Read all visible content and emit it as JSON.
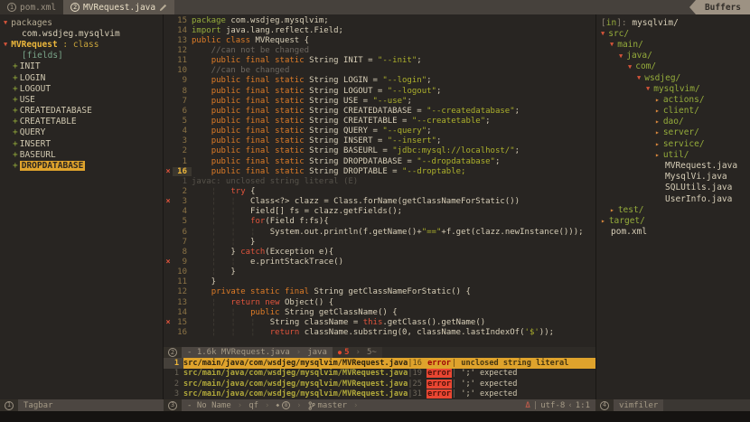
{
  "tabline": {
    "tabs": [
      {
        "num": "1",
        "label": "pom.xml"
      },
      {
        "num": "2",
        "label": "MVRequest.java"
      }
    ],
    "buffers_label": "Buffers"
  },
  "tagbar": {
    "items": [
      {
        "ind": 0,
        "arrow": "▼",
        "segs": [
          [
            "tb-top",
            "packages"
          ]
        ]
      },
      {
        "ind": 4,
        "segs": [
          [
            "tb-light",
            "com.wsdjeg.mysqlvim"
          ]
        ]
      },
      {
        "ind": 0,
        "arrow": "▼",
        "segs": [
          [
            "tb-name",
            "MVRequest"
          ],
          [
            "tb-kind",
            " : class"
          ]
        ]
      },
      {
        "ind": 4,
        "segs": [
          [
            "tb-fields",
            "[fields]"
          ]
        ]
      },
      {
        "ind": 2,
        "segs": [
          [
            "tb-plus",
            "+"
          ],
          [
            "tb-item",
            "INIT"
          ]
        ]
      },
      {
        "ind": 2,
        "segs": [
          [
            "tb-plus",
            "+"
          ],
          [
            "tb-item",
            "LOGIN"
          ]
        ]
      },
      {
        "ind": 2,
        "segs": [
          [
            "tb-plus",
            "+"
          ],
          [
            "tb-item",
            "LOGOUT"
          ]
        ]
      },
      {
        "ind": 2,
        "segs": [
          [
            "tb-plus",
            "+"
          ],
          [
            "tb-item",
            "USE"
          ]
        ]
      },
      {
        "ind": 2,
        "segs": [
          [
            "tb-plus",
            "+"
          ],
          [
            "tb-item",
            "CREATEDATABASE"
          ]
        ]
      },
      {
        "ind": 2,
        "segs": [
          [
            "tb-plus",
            "+"
          ],
          [
            "tb-item",
            "CREATETABLE"
          ]
        ]
      },
      {
        "ind": 2,
        "segs": [
          [
            "tb-plus",
            "+"
          ],
          [
            "tb-item",
            "QUERY"
          ]
        ]
      },
      {
        "ind": 2,
        "segs": [
          [
            "tb-plus",
            "+"
          ],
          [
            "tb-item",
            "INSERT"
          ]
        ]
      },
      {
        "ind": 2,
        "segs": [
          [
            "tb-plus",
            "+"
          ],
          [
            "tb-item",
            "BASEURL"
          ]
        ]
      },
      {
        "ind": 2,
        "segs": [
          [
            "tb-plus",
            "+"
          ],
          [
            "tb-sel",
            "DROPDATABASE"
          ]
        ]
      }
    ],
    "status_num": "1",
    "status_label": "Tagbar"
  },
  "code": {
    "lines": [
      {
        "nr": "15",
        "segs": [
          [
            "pkg",
            "package "
          ],
          [
            "idf",
            "com.wsdjeg.mysqlvim;"
          ]
        ]
      },
      {
        "nr": "14",
        "segs": [
          [
            "pkg",
            "import "
          ],
          [
            "idf",
            "java.lang.reflect.Field;"
          ]
        ]
      },
      {
        "nr": "13",
        "segs": [
          [
            "kwo",
            "public class "
          ],
          [
            "idf",
            "MVRequest {"
          ]
        ]
      },
      {
        "nr": "12",
        "segs": [
          [
            "cmt",
            "    //can not be changed"
          ]
        ]
      },
      {
        "nr": "11",
        "segs": [
          [
            "idf",
            "    "
          ],
          [
            "kwo",
            "public final static "
          ],
          [
            "idf",
            "String INIT = "
          ],
          [
            "str",
            "\"--init\""
          ],
          [
            "idf",
            ";"
          ]
        ]
      },
      {
        "nr": "10",
        "segs": [
          [
            "cmt",
            "    //can be changed"
          ]
        ]
      },
      {
        "nr": "9",
        "segs": [
          [
            "idf",
            "    "
          ],
          [
            "kwo",
            "public final static "
          ],
          [
            "idf",
            "String LOGIN = "
          ],
          [
            "str",
            "\"--login\""
          ],
          [
            "idf",
            ";"
          ]
        ]
      },
      {
        "nr": "8",
        "segs": [
          [
            "idf",
            "    "
          ],
          [
            "kwo",
            "public final static "
          ],
          [
            "idf",
            "String LOGOUT = "
          ],
          [
            "str",
            "\"--logout\""
          ],
          [
            "idf",
            ";"
          ]
        ]
      },
      {
        "nr": "7",
        "segs": [
          [
            "idf",
            "    "
          ],
          [
            "kwo",
            "public final static "
          ],
          [
            "idf",
            "String USE = "
          ],
          [
            "str",
            "\"--use\""
          ],
          [
            "idf",
            ";"
          ]
        ]
      },
      {
        "nr": "6",
        "segs": [
          [
            "idf",
            "    "
          ],
          [
            "kwo",
            "public final static "
          ],
          [
            "idf",
            "String CREATEDATABASE = "
          ],
          [
            "str",
            "\"--createdatabase\""
          ],
          [
            "idf",
            ";"
          ]
        ]
      },
      {
        "nr": "5",
        "segs": [
          [
            "idf",
            "    "
          ],
          [
            "kwo",
            "public final static "
          ],
          [
            "idf",
            "String CREATETABLE = "
          ],
          [
            "str",
            "\"--createtable\""
          ],
          [
            "idf",
            ";"
          ]
        ]
      },
      {
        "nr": "4",
        "segs": [
          [
            "idf",
            "    "
          ],
          [
            "kwo",
            "public final static "
          ],
          [
            "idf",
            "String QUERY = "
          ],
          [
            "str",
            "\"--query\""
          ],
          [
            "idf",
            ";"
          ]
        ]
      },
      {
        "nr": "3",
        "segs": [
          [
            "idf",
            "    "
          ],
          [
            "kwo",
            "public final static "
          ],
          [
            "idf",
            "String INSERT = "
          ],
          [
            "str",
            "\"--insert\""
          ],
          [
            "idf",
            ";"
          ]
        ]
      },
      {
        "nr": "2",
        "segs": [
          [
            "idf",
            "    "
          ],
          [
            "kwo",
            "public final static "
          ],
          [
            "idf",
            "String BASEURL = "
          ],
          [
            "str",
            "\"jdbc:mysql://localhost/\""
          ],
          [
            "idf",
            ";"
          ]
        ]
      },
      {
        "nr": "1",
        "segs": [
          [
            "idf",
            "    "
          ],
          [
            "kwo",
            "public final static "
          ],
          [
            "idf",
            "String DROPDATABASE = "
          ],
          [
            "str",
            "\"--dropdatabase\""
          ],
          [
            "idf",
            ";"
          ]
        ]
      },
      {
        "nr": "16",
        "cur": true,
        "sign": "×",
        "segs": [
          [
            "idf",
            "    "
          ],
          [
            "kwo",
            "public final static "
          ],
          [
            "idf",
            "String DROPTABLE = "
          ],
          [
            "str",
            "\"--droptable;"
          ]
        ]
      },
      {
        "nr": "1",
        "dim": true,
        "virt": true,
        "segs": [
          [
            "virt",
            "javac: unclosed string literal (E)"
          ]
        ]
      },
      {
        "nr": "2",
        "segs": [
          [
            "idf",
            "    "
          ],
          [
            "gde",
            "¦"
          ],
          [
            "idf",
            "   "
          ],
          [
            "kwr",
            "try "
          ],
          [
            "idf",
            "{"
          ]
        ]
      },
      {
        "nr": "3",
        "sign": "×",
        "segs": [
          [
            "idf",
            "    "
          ],
          [
            "gde",
            "¦"
          ],
          [
            "idf",
            "   "
          ],
          [
            "gde",
            "¦"
          ],
          [
            "idf",
            "   Class<?> clazz = Class.forName(getClassNameForStatic())"
          ]
        ]
      },
      {
        "nr": "4",
        "segs": [
          [
            "idf",
            "    "
          ],
          [
            "gde",
            "¦"
          ],
          [
            "idf",
            "   "
          ],
          [
            "gde",
            "¦"
          ],
          [
            "idf",
            "   Field[] fs = clazz.getFields();"
          ]
        ]
      },
      {
        "nr": "5",
        "segs": [
          [
            "idf",
            "    "
          ],
          [
            "gde",
            "¦"
          ],
          [
            "idf",
            "   "
          ],
          [
            "gde",
            "¦"
          ],
          [
            "idf",
            "   "
          ],
          [
            "kwr",
            "for"
          ],
          [
            "idf",
            "(Field f:fs){"
          ]
        ]
      },
      {
        "nr": "6",
        "segs": [
          [
            "idf",
            "    "
          ],
          [
            "gde",
            "¦"
          ],
          [
            "idf",
            "   "
          ],
          [
            "gde",
            "¦"
          ],
          [
            "idf",
            "   "
          ],
          [
            "gde",
            "¦"
          ],
          [
            "idf",
            "   System.out.println(f.getName()+"
          ],
          [
            "str",
            "\"==\""
          ],
          [
            "idf",
            "+f.get(clazz.newInstance()));"
          ]
        ]
      },
      {
        "nr": "7",
        "segs": [
          [
            "idf",
            "    "
          ],
          [
            "gde",
            "¦"
          ],
          [
            "idf",
            "   "
          ],
          [
            "gde",
            "¦"
          ],
          [
            "idf",
            "   }"
          ]
        ]
      },
      {
        "nr": "8",
        "segs": [
          [
            "idf",
            "    "
          ],
          [
            "gde",
            "¦"
          ],
          [
            "idf",
            "   } "
          ],
          [
            "kwr",
            "catch"
          ],
          [
            "idf",
            "(Exception e){"
          ]
        ]
      },
      {
        "nr": "9",
        "sign": "×",
        "segs": [
          [
            "idf",
            "    "
          ],
          [
            "gde",
            "¦"
          ],
          [
            "idf",
            "   "
          ],
          [
            "gde",
            "¦"
          ],
          [
            "idf",
            "   e.printStackTrace()"
          ]
        ]
      },
      {
        "nr": "10",
        "segs": [
          [
            "idf",
            "    "
          ],
          [
            "gde",
            "¦"
          ],
          [
            "idf",
            "   }"
          ]
        ]
      },
      {
        "nr": "11",
        "segs": [
          [
            "idf",
            "    }"
          ]
        ]
      },
      {
        "nr": "12",
        "segs": [
          [
            "idf",
            "    "
          ],
          [
            "kwo",
            "private static final "
          ],
          [
            "idf",
            "String getClassNameForStatic() {"
          ]
        ]
      },
      {
        "nr": "13",
        "segs": [
          [
            "idf",
            "    "
          ],
          [
            "gde",
            "¦"
          ],
          [
            "idf",
            "   "
          ],
          [
            "kwr",
            "return new "
          ],
          [
            "idf",
            "Object() {"
          ]
        ]
      },
      {
        "nr": "14",
        "segs": [
          [
            "idf",
            "    "
          ],
          [
            "gde",
            "¦"
          ],
          [
            "idf",
            "   "
          ],
          [
            "gde",
            "¦"
          ],
          [
            "idf",
            "   "
          ],
          [
            "kwo",
            "public "
          ],
          [
            "idf",
            "String getClassName() {"
          ]
        ]
      },
      {
        "nr": "15",
        "sign": "×",
        "segs": [
          [
            "idf",
            "    "
          ],
          [
            "gde",
            "¦"
          ],
          [
            "idf",
            "   "
          ],
          [
            "gde",
            "¦"
          ],
          [
            "idf",
            "   "
          ],
          [
            "gde",
            "¦"
          ],
          [
            "idf",
            "   String className = "
          ],
          [
            "kwr",
            "this"
          ],
          [
            "idf",
            ".getClass().getName()"
          ]
        ]
      },
      {
        "nr": "16",
        "segs": [
          [
            "idf",
            "    "
          ],
          [
            "gde",
            "¦"
          ],
          [
            "idf",
            "   "
          ],
          [
            "gde",
            "¦"
          ],
          [
            "idf",
            "   "
          ],
          [
            "gde",
            "¦"
          ],
          [
            "idf",
            "   "
          ],
          [
            "kwr",
            "return "
          ],
          [
            "idf",
            "className.substring(0, className.lastIndexOf("
          ],
          [
            "str",
            "'$'"
          ],
          [
            "idf",
            "));"
          ]
        ]
      }
    ]
  },
  "buffer_status": {
    "num": "2",
    "info": "- 1.6k MVRequest.java",
    "filetype": "java",
    "err_dot": "●",
    "err_count": "5",
    "scroll": "5~"
  },
  "quickfix": {
    "rows": [
      {
        "nr": "1",
        "cur": true,
        "path": "src/main/java/com/wsdjeg/mysqlvim/MVRequest.java",
        "line": "16",
        "tag": "error",
        "msg": "unclosed string literal"
      },
      {
        "nr": "1",
        "path": "src/main/java/com/wsdjeg/mysqlvim/MVRequest.java",
        "line": "19",
        "tag": "error",
        "msg": "';' expected"
      },
      {
        "nr": "2",
        "path": "src/main/java/com/wsdjeg/mysqlvim/MVRequest.java",
        "line": "25",
        "tag": "error",
        "msg": "';' expected"
      },
      {
        "nr": "3",
        "path": "src/main/java/com/wsdjeg/mysqlvim/MVRequest.java",
        "line": "31",
        "tag": "error",
        "msg": "';' expected"
      }
    ]
  },
  "qf_status": {
    "num": "3",
    "name": "- No Name",
    "filetype": "qf",
    "diamond": "◆",
    "count": "8",
    "branch": "master",
    "os": "Δ",
    "sep": "|",
    "encoding": "utf-8",
    "sep2": "‹",
    "position": "1:1"
  },
  "filer": {
    "header_open": "[",
    "header_mode": "in",
    "header_close": "]: ",
    "header_path": "mysqlvim/",
    "items": [
      {
        "ind": 0,
        "arrow": "▼",
        "open": true,
        "dir": true,
        "name": "src/"
      },
      {
        "ind": 1,
        "arrow": "▼",
        "open": true,
        "dir": true,
        "name": "main/"
      },
      {
        "ind": 2,
        "arrow": "▼",
        "open": true,
        "dir": true,
        "name": "java/"
      },
      {
        "ind": 3,
        "arrow": "▼",
        "open": true,
        "dir": true,
        "name": "com/"
      },
      {
        "ind": 4,
        "arrow": "▼",
        "open": true,
        "dir": true,
        "name": "wsdjeg/"
      },
      {
        "ind": 5,
        "arrow": "▼",
        "open": true,
        "dir": true,
        "name": "mysqlvim/"
      },
      {
        "ind": 6,
        "arrow": "▸",
        "dir": true,
        "name": "actions/"
      },
      {
        "ind": 6,
        "arrow": "▸",
        "dir": true,
        "name": "client/"
      },
      {
        "ind": 6,
        "arrow": "▸",
        "dir": true,
        "name": "dao/"
      },
      {
        "ind": 6,
        "arrow": "▸",
        "dir": true,
        "name": "server/"
      },
      {
        "ind": 6,
        "arrow": "▸",
        "dir": true,
        "name": "service/"
      },
      {
        "ind": 6,
        "arrow": "▸",
        "dir": true,
        "name": "util/"
      },
      {
        "ind": 6,
        "file": true,
        "name": "MVRequest.java"
      },
      {
        "ind": 6,
        "file": true,
        "name": "MysqlVi.java"
      },
      {
        "ind": 6,
        "file": true,
        "name": "SQLUtils.java"
      },
      {
        "ind": 6,
        "file": true,
        "name": "UserInfo.java"
      },
      {
        "ind": 1,
        "arrow": "▸",
        "dir": true,
        "name": "test/"
      },
      {
        "ind": 0,
        "arrow": "▸",
        "dir": true,
        "name": "target/"
      },
      {
        "ind": 0,
        "file": true,
        "name": "pom.xml"
      }
    ],
    "status_num": "4",
    "status_label": "vimfiler"
  }
}
